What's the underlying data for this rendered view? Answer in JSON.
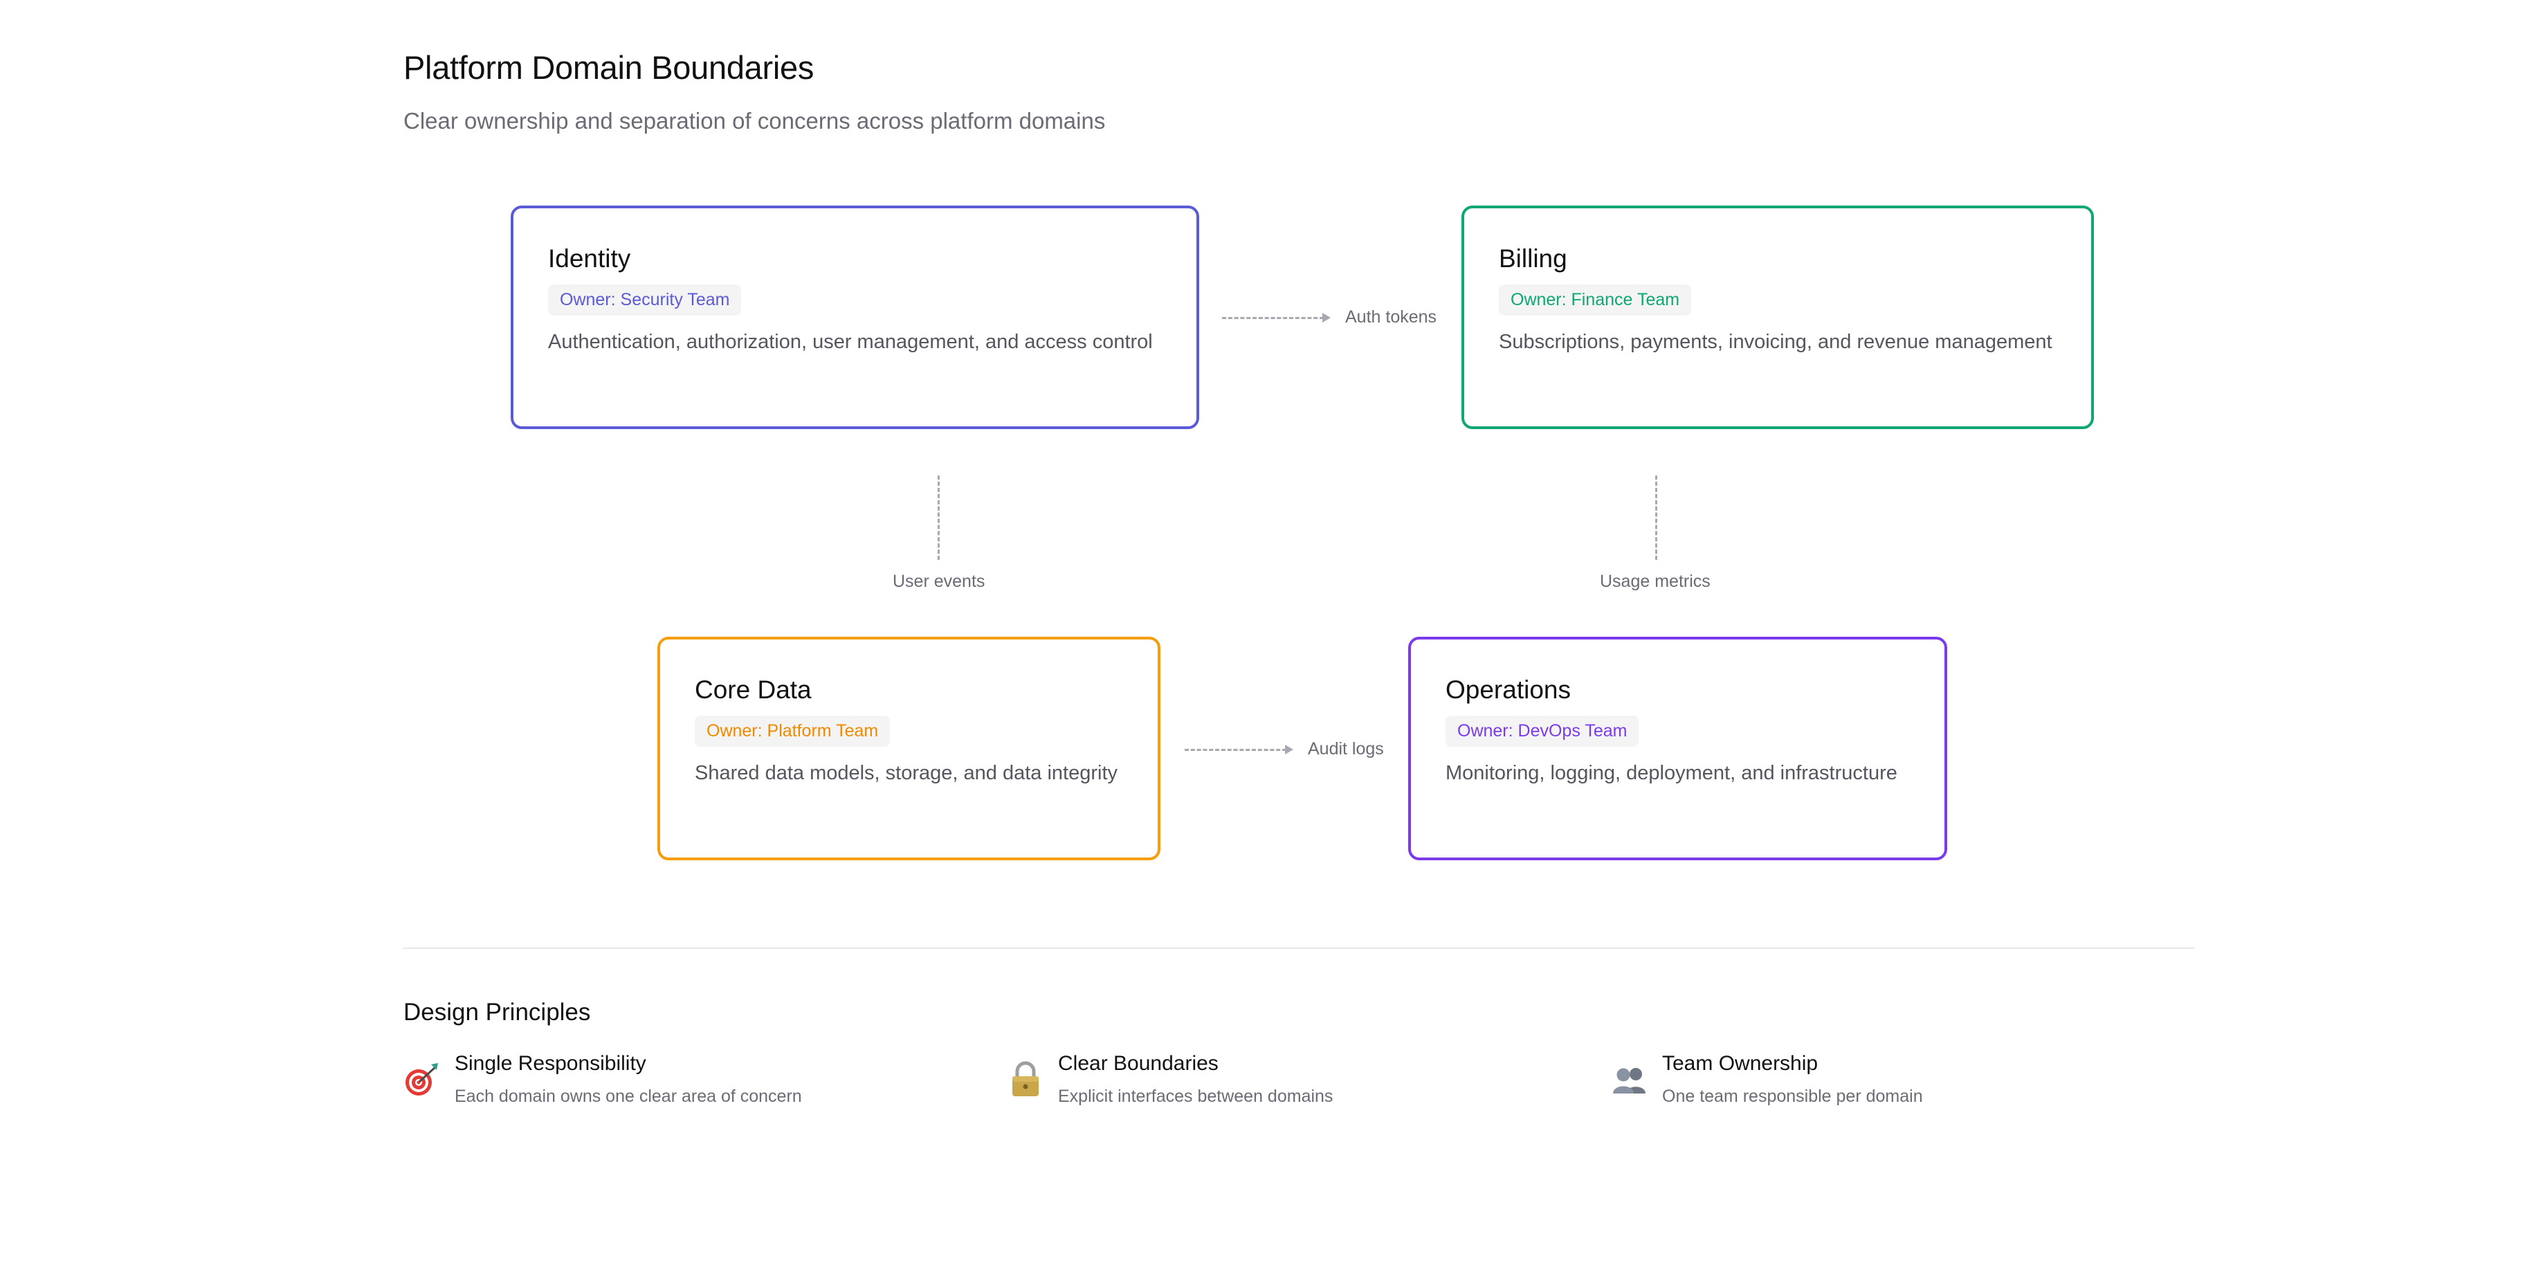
{
  "header": {
    "title": "Platform Domain Boundaries",
    "subtitle": "Clear ownership and separation of concerns across platform domains"
  },
  "domains": [
    {
      "name": "Identity",
      "owner": "Owner: Security Team",
      "description": "Authentication, authorization, user management, and access control",
      "color": "#5b5bd6"
    },
    {
      "name": "Billing",
      "owner": "Owner: Finance Team",
      "description": "Subscriptions, payments, invoicing, and revenue management",
      "color": "#10a772"
    },
    {
      "name": "Core Data",
      "owner": "Owner: Platform Team",
      "description": "Shared data models, storage, and data integrity",
      "color": "#f59e0b"
    },
    {
      "name": "Operations",
      "owner": "Owner: DevOps Team",
      "description": "Monitoring, logging, deployment, and infrastructure",
      "color": "#7c3aed"
    }
  ],
  "connections": {
    "identity_billing": "Auth tokens",
    "identity_coredata": "User events",
    "billing_operations": "Usage metrics",
    "coredata_operations": "Audit logs"
  },
  "principles": {
    "title": "Design Principles",
    "items": [
      {
        "icon": "target-icon",
        "title": "Single Responsibility",
        "description": "Each domain owns one clear area of concern"
      },
      {
        "icon": "lock-icon",
        "title": "Clear Boundaries",
        "description": "Explicit interfaces between domains"
      },
      {
        "icon": "users-icon",
        "title": "Team Ownership",
        "description": "One team responsible per domain"
      }
    ]
  }
}
